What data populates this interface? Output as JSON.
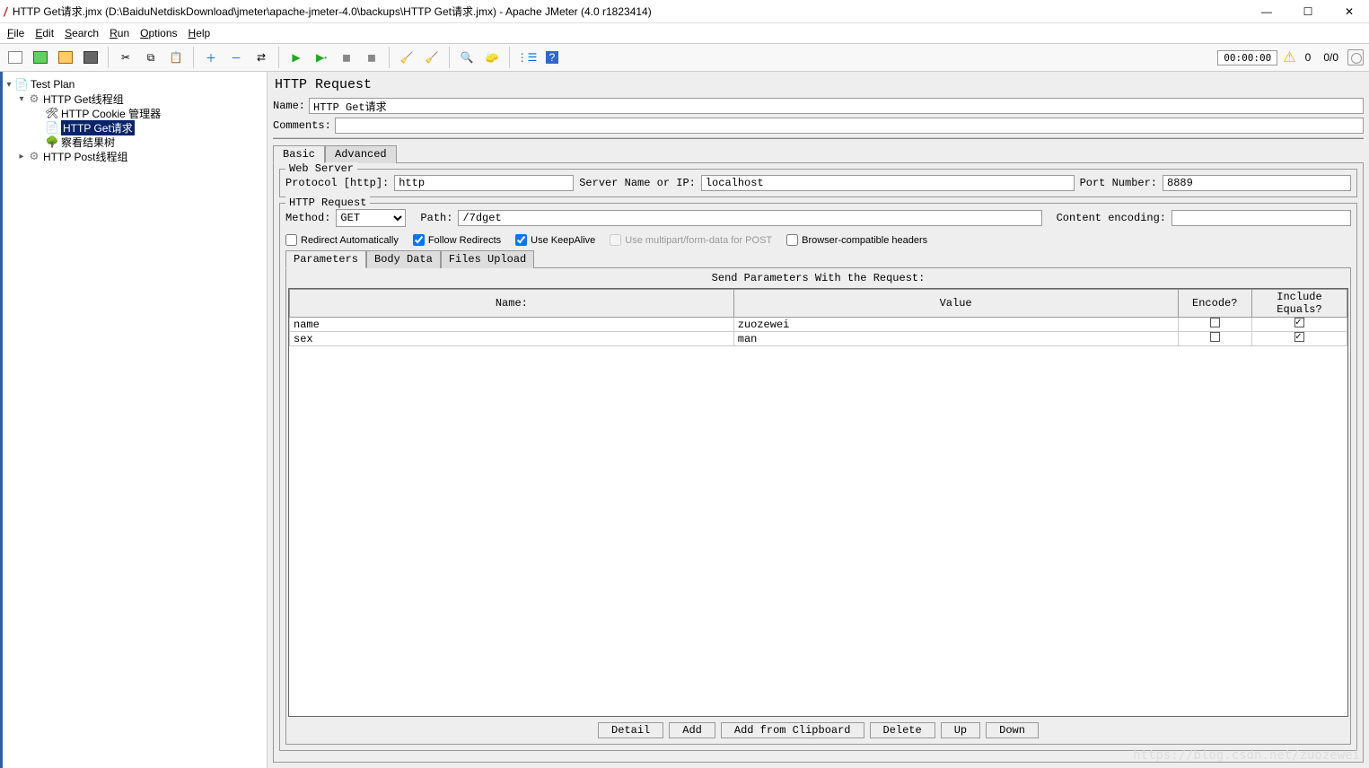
{
  "window": {
    "title": "HTTP Get请求.jmx (D:\\BaiduNetdiskDownload\\jmeter\\apache-jmeter-4.0\\backups\\HTTP Get请求.jmx) - Apache JMeter (4.0 r1823414)"
  },
  "menu": {
    "file": "File",
    "edit": "Edit",
    "search": "Search",
    "run": "Run",
    "options": "Options",
    "help": "Help"
  },
  "toolbar": {
    "timer": "00:00:00",
    "warn_count": "0",
    "active": "0/0"
  },
  "tree": {
    "root": "Test Plan",
    "g1": "HTTP Get线程组",
    "g1_cookie": "HTTP Cookie 管理器",
    "g1_req": "HTTP Get请求",
    "g1_tree": "察看结果树",
    "g2": "HTTP Post线程组"
  },
  "panel": {
    "title": "HTTP Request",
    "name_label": "Name:",
    "name_value": "HTTP Get请求",
    "comments_label": "Comments:",
    "comments_value": "",
    "tab_basic": "Basic",
    "tab_advanced": "Advanced"
  },
  "webserver": {
    "legend": "Web Server",
    "protocol_label": "Protocol [http]:",
    "protocol_value": "http",
    "server_label": "Server Name or IP:",
    "server_value": "localhost",
    "port_label": "Port Number:",
    "port_value": "8889"
  },
  "httprequest": {
    "legend": "HTTP Request",
    "method_label": "Method:",
    "method_value": "GET",
    "path_label": "Path:",
    "path_value": "/7dget",
    "encoding_label": "Content encoding:",
    "encoding_value": "",
    "chk_redirect_auto": "Redirect Automatically",
    "chk_follow": "Follow Redirects",
    "chk_keepalive": "Use KeepAlive",
    "chk_multipart": "Use multipart/form-data for POST",
    "chk_browser": "Browser-compatible headers"
  },
  "subtabs": {
    "parameters": "Parameters",
    "body": "Body Data",
    "files": "Files Upload"
  },
  "params": {
    "title": "Send Parameters With the Request:",
    "col_name": "Name:",
    "col_value": "Value",
    "col_encode": "Encode?",
    "col_equals": "Include Equals?",
    "rows": [
      {
        "name": "name",
        "value": "zuozewei",
        "encode": false,
        "equals": true
      },
      {
        "name": "sex",
        "value": "man",
        "encode": false,
        "equals": true
      }
    ]
  },
  "buttons": {
    "detail": "Detail",
    "add": "Add",
    "clipboard": "Add from Clipboard",
    "delete": "Delete",
    "up": "Up",
    "down": "Down"
  },
  "watermark": "https://blog.csdn.net/zuozewei"
}
